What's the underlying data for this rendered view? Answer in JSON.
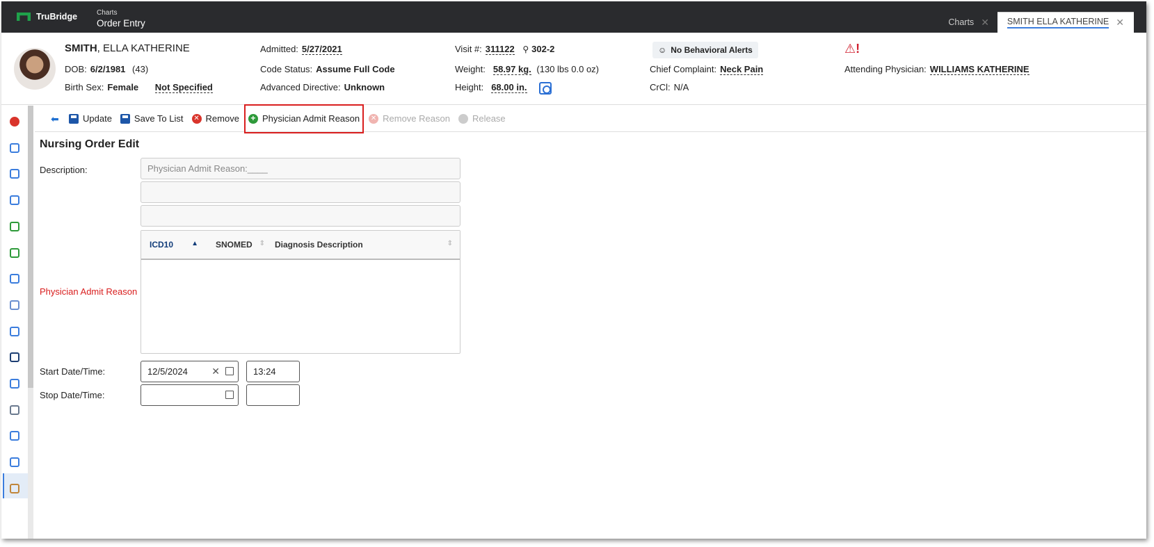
{
  "topbar": {
    "brand": "TruBridge",
    "app_small": "Charts",
    "app_title": "Order Entry",
    "tabs": [
      {
        "label": "Charts",
        "active": false
      },
      {
        "label": "SMITH ELLA KATHERINE",
        "active": true
      }
    ]
  },
  "patient": {
    "last_name": "SMITH",
    "first_names": ", ELLA KATHERINE",
    "dob_label": "DOB:",
    "dob": "6/2/1981",
    "age": "(43)",
    "sex_label": "Birth Sex:",
    "sex": "Female",
    "gender": "Not Specified",
    "admitted_label": "Admitted:",
    "admitted": "5/27/2021",
    "code_status_label": "Code Status:",
    "code_status": "Assume Full Code",
    "directive_label": "Advanced Directive:",
    "directive": "Unknown",
    "visit_label": "Visit #:",
    "visit": "311122",
    "room": "302-2",
    "weight_label": "Weight:",
    "weight": "58.97 kg.",
    "weight_alt": "(130 lbs 0.0 oz)",
    "height_label": "Height:",
    "height": "68.00 in.",
    "behavioral": "No Behavioral Alerts",
    "complaint_label": "Chief Complaint:",
    "complaint": "Neck Pain",
    "crcl_label": "CrCl:",
    "crcl": "N/A",
    "attending_label": "Attending Physician:",
    "attending": "WILLIAMS KATHERINE"
  },
  "toolbar": {
    "update": "Update",
    "save_to_list": "Save To List",
    "remove": "Remove",
    "physician_admit_reason": "Physician Admit Reason",
    "remove_reason": "Remove Reason",
    "release": "Release"
  },
  "form": {
    "title": "Nursing Order Edit",
    "description_label": "Description:",
    "description_lines": [
      "Physician Admit Reason:____",
      "",
      ""
    ],
    "admit_reason_label": "Physician Admit Reason",
    "grid_headers": [
      "ICD10",
      "SNOMED",
      "Diagnosis Description"
    ],
    "start_label": "Start Date/Time:",
    "start_date": "12/5/2024",
    "start_time": "13:24",
    "stop_label": "Stop Date/Time:",
    "stop_date": "",
    "stop_time": ""
  },
  "colors": {
    "topbar_bg": "#2a2b2e",
    "accent": "#3b7ddd",
    "required": "#d91e1e",
    "brand_green": "#1fa24b"
  },
  "sidebar_icons": [
    "alert-icon",
    "lab-flask-icon",
    "checklist-icon",
    "calendar-plus-icon",
    "palette-icon",
    "vitals-icon",
    "notes-icon",
    "syringe-icon",
    "nurse-icon",
    "monitor-icon",
    "document-icon",
    "report-icon",
    "chart-icon",
    "attachment-icon",
    "order-icon"
  ]
}
